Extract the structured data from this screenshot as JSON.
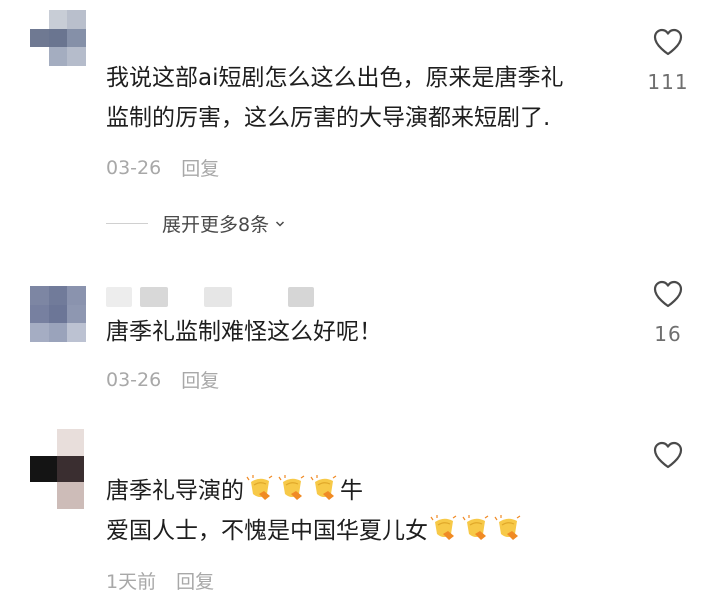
{
  "comments": [
    {
      "lines": [
        "我说这部ai短剧怎么这么出色，原来是唐季礼",
        "监制的厉害，这么厉害的大导演都来短剧了."
      ],
      "date": "03-26",
      "reply": "回复",
      "likes": "111"
    },
    {
      "lines": [
        "唐季礼监制难怪这么好呢！"
      ],
      "date": "03-26",
      "reply": "回复",
      "likes": "16"
    },
    {
      "line1_text": "唐季礼导演的",
      "line1_tail": "牛",
      "line2_text": "爱国人士，不愧是中国华夏儿女",
      "date": "1天前",
      "reply": "回复"
    }
  ],
  "expand_label": "展开更多8条",
  "icons": {
    "like": "heart-outline-icon",
    "expand": "chevron-down-icon",
    "emoji": "clapping-hands-emoji-icon"
  },
  "colors": {
    "text": "#1e1e1e",
    "meta": "#a8a8a8",
    "count": "#6f6f6f",
    "emoji_yellow": "#f7c948",
    "emoji_orange": "#f08a24"
  }
}
